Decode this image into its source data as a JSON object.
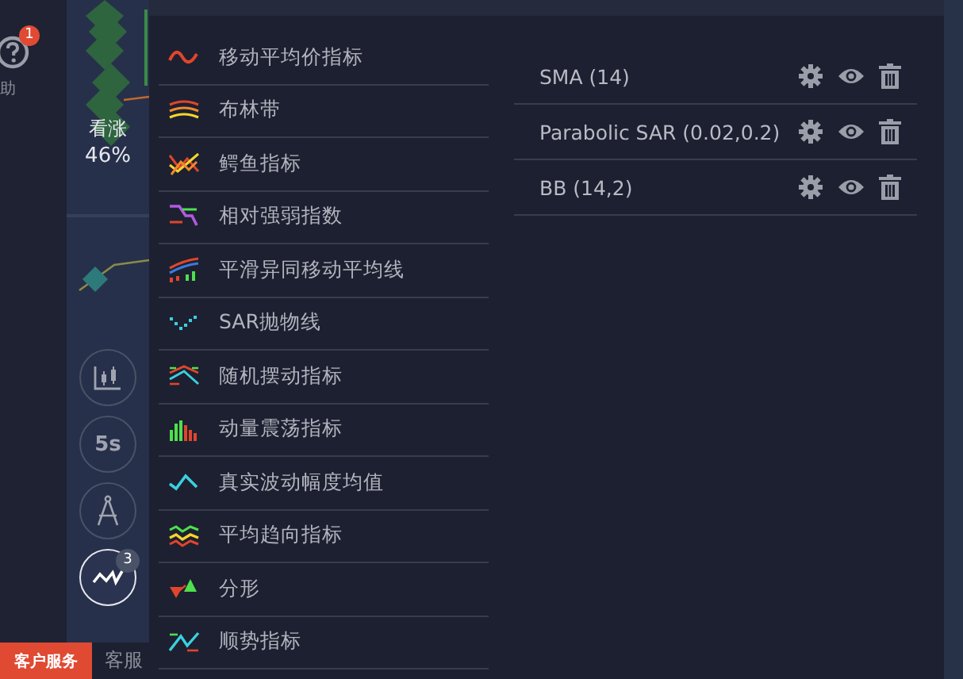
{
  "sidebar": {
    "help": {
      "label": "助",
      "badge": "1"
    }
  },
  "chart_strip": {
    "direction": "看涨",
    "percent": "46%"
  },
  "tools": [
    {
      "kind": "candles",
      "selected": false
    },
    {
      "kind": "text",
      "label": "5s",
      "selected": false
    },
    {
      "kind": "compass",
      "selected": false
    },
    {
      "kind": "indicators",
      "badge": "3",
      "selected": true
    }
  ],
  "indicator_menu": [
    {
      "label": "移动平均价指标",
      "kind": "wave"
    },
    {
      "label": "布林带",
      "kind": "bands"
    },
    {
      "label": "鳄鱼指标",
      "kind": "alligator"
    },
    {
      "label": "相对强弱指数",
      "kind": "rsi"
    },
    {
      "label": "平滑异同移动平均线",
      "kind": "macd"
    },
    {
      "label": "SAR抛物线",
      "kind": "dots"
    },
    {
      "label": "随机摆动指标",
      "kind": "stoch"
    },
    {
      "label": "动量震荡指标",
      "kind": "bars"
    },
    {
      "label": "真实波动幅度均值",
      "kind": "atr"
    },
    {
      "label": "平均趋向指标",
      "kind": "adx"
    },
    {
      "label": "分形",
      "kind": "fractal"
    },
    {
      "label": "顺势指标",
      "kind": "cci"
    }
  ],
  "active_indicators": [
    {
      "name": "SMA (14)"
    },
    {
      "name": "Parabolic SAR (0.02,0.2)"
    },
    {
      "name": "BB (14,2)"
    }
  ],
  "bottom_bar": {
    "support_button": "客户服务",
    "support_label": "客服"
  }
}
